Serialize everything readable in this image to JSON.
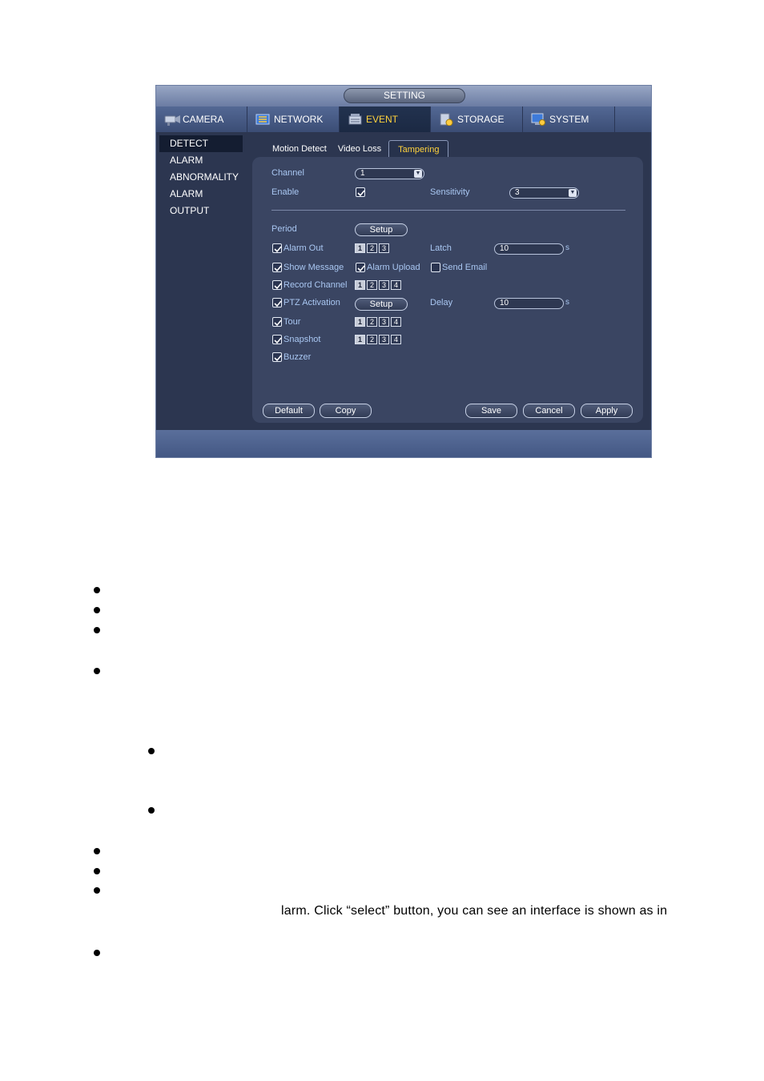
{
  "window": {
    "title": "SETTING"
  },
  "nav_tabs": [
    {
      "label": "CAMERA",
      "icon": "camera-icon"
    },
    {
      "label": "NETWORK",
      "icon": "network-icon"
    },
    {
      "label": "EVENT",
      "icon": "event-icon",
      "active": true
    },
    {
      "label": "STORAGE",
      "icon": "storage-icon"
    },
    {
      "label": "SYSTEM",
      "icon": "system-icon"
    }
  ],
  "sidebar": {
    "items": [
      {
        "label": "DETECT",
        "active": true
      },
      {
        "label": "ALARM"
      },
      {
        "label": "ABNORMALITY"
      },
      {
        "label": "ALARM OUTPUT"
      }
    ]
  },
  "subtabs": [
    {
      "label": "Motion Detect"
    },
    {
      "label": "Video Loss"
    },
    {
      "label": "Tampering",
      "active": true
    }
  ],
  "form": {
    "channel_label": "Channel",
    "channel_value": "1",
    "enable_label": "Enable",
    "enable_checked": true,
    "sensitivity_label": "Sensitivity",
    "sensitivity_value": "3",
    "period_label": "Period",
    "setup_label": "Setup",
    "alarm_out_label": "Alarm Out",
    "alarm_out_nums": [
      "1",
      "2",
      "3"
    ],
    "latch_label": "Latch",
    "latch_value": "10",
    "unit_s": "s",
    "show_message_label": "Show Message",
    "alarm_upload_label": "Alarm Upload",
    "send_email_label": "Send Email",
    "record_channel_label": "Record Channel",
    "record_nums": [
      "1",
      "2",
      "3",
      "4"
    ],
    "ptz_label": "PTZ Activation",
    "ptz_setup_label": "Setup",
    "delay_label": "Delay",
    "delay_value": "10",
    "tour_label": "Tour",
    "tour_nums": [
      "1",
      "2",
      "3",
      "4"
    ],
    "snapshot_label": "Snapshot",
    "snapshot_nums": [
      "1",
      "2",
      "3",
      "4"
    ],
    "buzzer_label": "Buzzer"
  },
  "buttons": {
    "default": "Default",
    "copy": "Copy",
    "save": "Save",
    "cancel": "Cancel",
    "apply": "Apply"
  },
  "doc": {
    "partial_line": "larm. Click “select” button, you can see an interface is shown as in"
  },
  "colors": {
    "accent": "#ffd23c",
    "label": "#a9c7f2",
    "panel": "#3a4562",
    "background": "#2c3650"
  }
}
